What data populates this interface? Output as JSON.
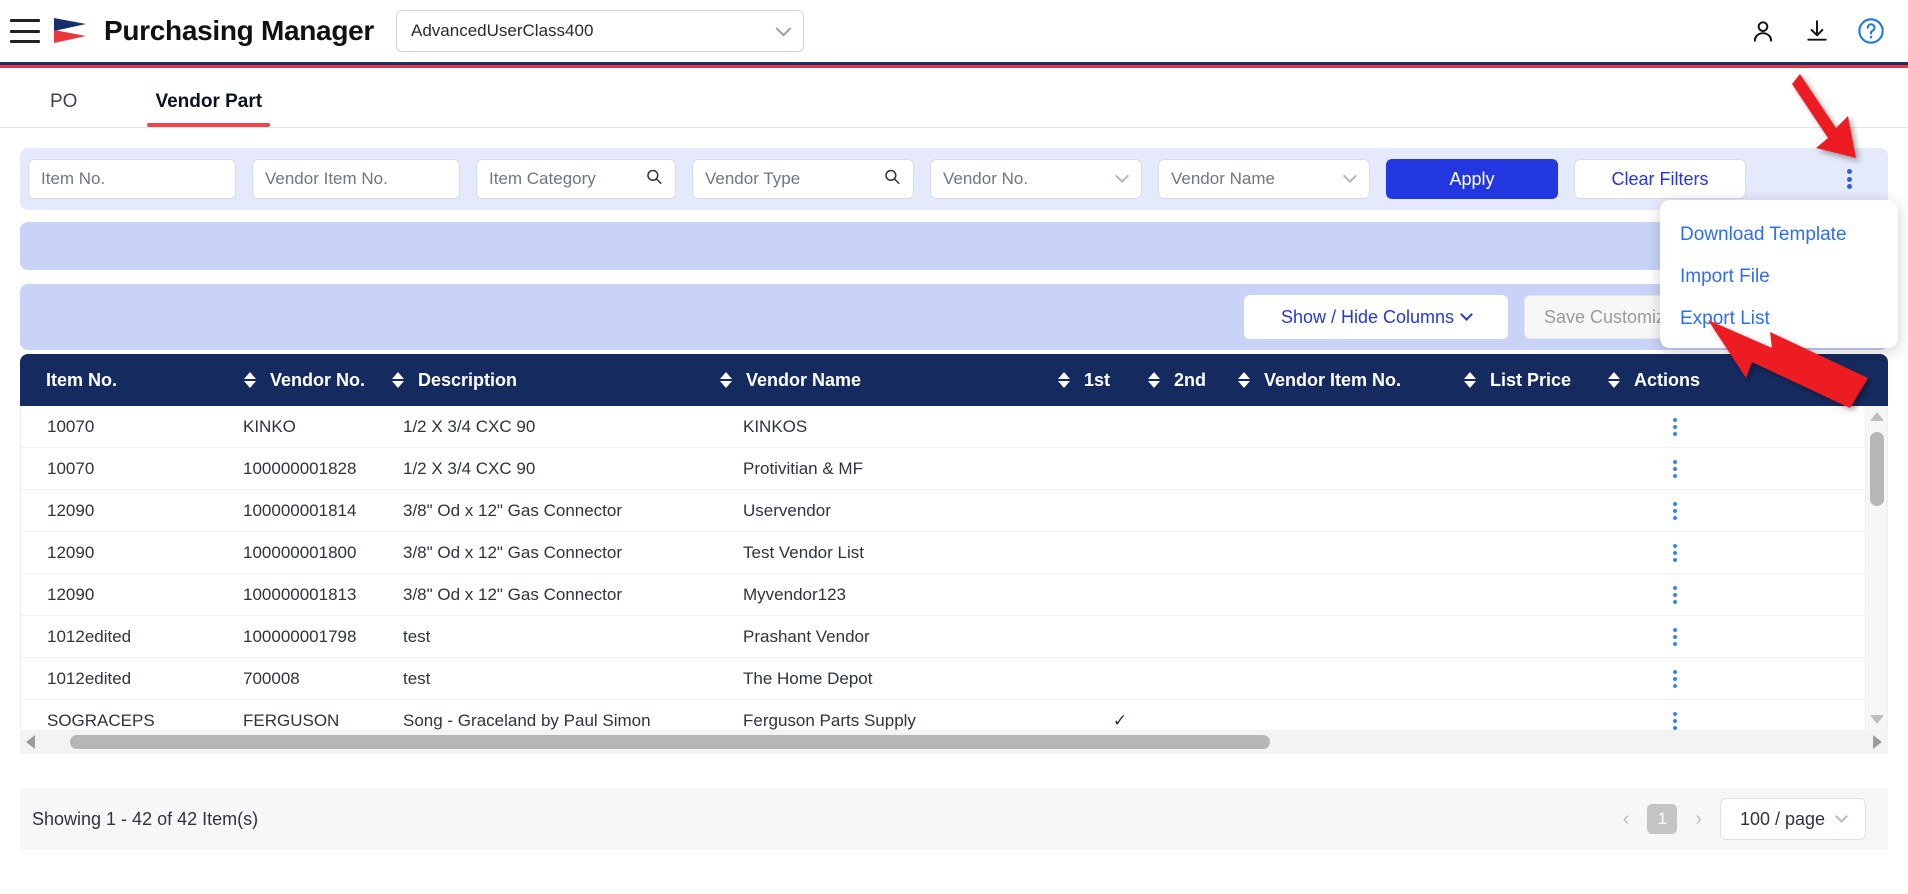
{
  "header": {
    "menu_icon": "hamburger-icon",
    "title": "Purchasing Manager",
    "user_class_value": "AdvancedUserClass400",
    "icons": [
      "user-icon",
      "download-icon",
      "help-icon"
    ]
  },
  "tabs": [
    {
      "label": "PO",
      "active": false
    },
    {
      "label": "Vendor Part",
      "active": true
    }
  ],
  "filters": {
    "item_no_placeholder": "Item No.",
    "vendor_item_no_placeholder": "Vendor Item No.",
    "item_category_placeholder": "Item Category",
    "vendor_type_placeholder": "Vendor Type",
    "vendor_no_placeholder": "Vendor No.",
    "vendor_name_placeholder": "Vendor Name",
    "apply_label": "Apply",
    "clear_label": "Clear Filters",
    "more_icon": "kebab-menu-icon"
  },
  "toolbar": {
    "show_hide_columns_label": "Show / Hide Columns",
    "save_customization_label": "Save Customization"
  },
  "context_menu": {
    "items": [
      "Download Template",
      "Import File",
      "Export List"
    ]
  },
  "table": {
    "columns": [
      {
        "label": "Item No.",
        "sortable": true
      },
      {
        "label": "Vendor No.",
        "sortable": true
      },
      {
        "label": "Description",
        "sortable": true
      },
      {
        "label": "Vendor Name",
        "sortable": true
      },
      {
        "label": "1st",
        "sortable": true
      },
      {
        "label": "2nd",
        "sortable": true
      },
      {
        "label": "Vendor Item No.",
        "sortable": true
      },
      {
        "label": "List Price",
        "sortable": true
      },
      {
        "label": "Actions",
        "sortable": false
      }
    ],
    "rows": [
      {
        "item_no": "10070",
        "vendor_no": "KINKO",
        "description": "1/2 X 3/4 CXC 90",
        "vendor_name": "KINKOS",
        "first": "",
        "second": "",
        "vendor_item_no": "",
        "list_price": ""
      },
      {
        "item_no": "10070",
        "vendor_no": "100000001828",
        "description": "1/2 X 3/4 CXC 90",
        "vendor_name": "Protivitian & MF",
        "first": "",
        "second": "",
        "vendor_item_no": "",
        "list_price": ""
      },
      {
        "item_no": "12090",
        "vendor_no": "100000001814",
        "description": "3/8\" Od x 12\" Gas Connector",
        "vendor_name": "Uservendor",
        "first": "",
        "second": "",
        "vendor_item_no": "",
        "list_price": ""
      },
      {
        "item_no": "12090",
        "vendor_no": "100000001800",
        "description": "3/8\" Od x 12\" Gas Connector",
        "vendor_name": "Test Vendor List",
        "first": "",
        "second": "",
        "vendor_item_no": "",
        "list_price": ""
      },
      {
        "item_no": "12090",
        "vendor_no": "100000001813",
        "description": "3/8\" Od x 12\" Gas Connector",
        "vendor_name": "Myvendor123",
        "first": "",
        "second": "",
        "vendor_item_no": "",
        "list_price": ""
      },
      {
        "item_no": "1012edited",
        "vendor_no": "100000001798",
        "description": "test",
        "vendor_name": "Prashant Vendor",
        "first": "",
        "second": "",
        "vendor_item_no": "",
        "list_price": ""
      },
      {
        "item_no": "1012edited",
        "vendor_no": "700008",
        "description": "test",
        "vendor_name": "The Home Depot",
        "first": "",
        "second": "",
        "vendor_item_no": "",
        "list_price": ""
      },
      {
        "item_no": "SOGRACEPS",
        "vendor_no": "FERGUSON",
        "description": "Song - Graceland by Paul Simon",
        "vendor_name": "Ferguson Parts Supply",
        "first": "✓",
        "second": "",
        "vendor_item_no": "",
        "list_price": ""
      }
    ]
  },
  "footer": {
    "showing_text": "Showing 1 - 42 of 42 Item(s)",
    "prev_label": "‹",
    "page_number": "1",
    "next_label": "›",
    "per_page_label": "100 / page"
  },
  "colors": {
    "brand_navy": "#152a5e",
    "brand_red": "#e8373f",
    "primary_blue": "#2337e0",
    "filter_bg": "#e4e9fb",
    "bar_bg": "#c8d3f7",
    "link_blue": "#2e6ef0"
  }
}
